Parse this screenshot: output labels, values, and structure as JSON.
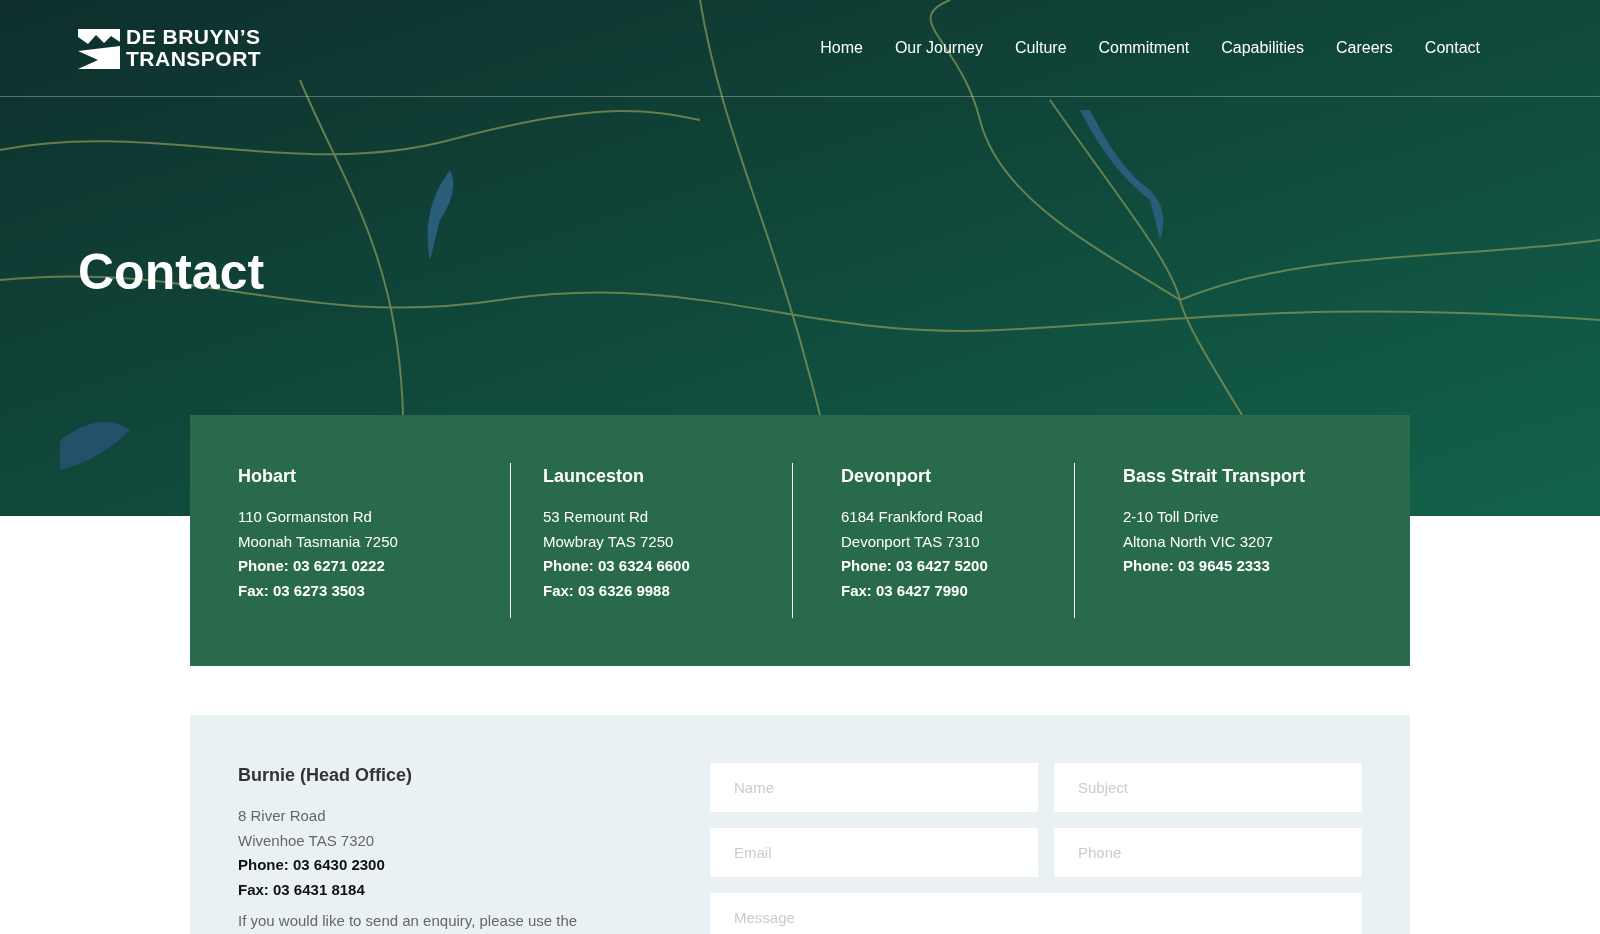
{
  "header": {
    "logo": {
      "line_1": "DE BRUYN’S",
      "line_2": "TRANSPORT"
    },
    "nav": [
      {
        "label": "Home"
      },
      {
        "label": "Our Journey"
      },
      {
        "label": "Culture"
      },
      {
        "label": "Commitment"
      },
      {
        "label": "Capabilities"
      },
      {
        "label": "Careers"
      },
      {
        "label": "Contact"
      }
    ]
  },
  "hero": {
    "kind": "picture",
    "title": "Contact"
  },
  "offices": [
    {
      "name": "Hobart",
      "lines": [
        "110 Gormanston Rd",
        "Moonah Tasmania 7250"
      ],
      "phone": "Phone: 03 6271 0222",
      "fax": "Fax: 03 6273 3503"
    },
    {
      "name": "Launceston",
      "lines": [
        "53 Remount Rd",
        "Mowbray TAS 7250"
      ],
      "phone": "Phone: 03 6324 6600",
      "fax": "Fax: 03 6326 9988"
    },
    {
      "name": "Devonport",
      "lines": [
        "6184 Frankford Road",
        "Devonport TAS 7310"
      ],
      "phone": "Phone: 03 6427 5200",
      "fax": "Fax: 03 6427 7990"
    },
    {
      "name": "Bass Strait Transport",
      "lines": [
        "2-10 Toll Drive",
        "Altona North VIC 3207"
      ],
      "phone": "Phone: 03 9645 2333"
    }
  ],
  "head_office": {
    "name": "Burnie (Head Office)",
    "lines": [
      "8 River Road",
      "Wivenhoe TAS 7320"
    ],
    "phone": "Phone: 03 6430 2300",
    "fax": "Fax: 03 6431 8184",
    "note": "If you would like to send an enquiry, please use the"
  },
  "form": {
    "fields": [
      {
        "placeholder": "Name"
      },
      {
        "placeholder": "Subject"
      },
      {
        "placeholder": "Email"
      },
      {
        "placeholder": "Phone"
      }
    ],
    "message": {
      "placeholder": "Message"
    }
  }
}
